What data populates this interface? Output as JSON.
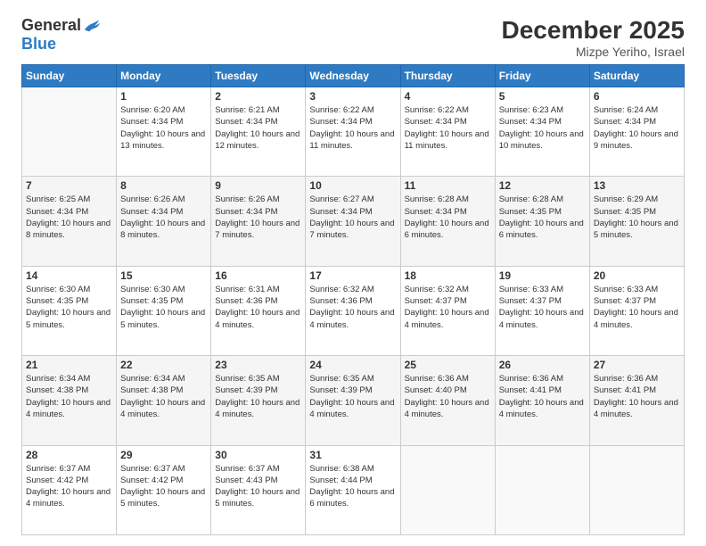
{
  "logo": {
    "general": "General",
    "blue": "Blue"
  },
  "header": {
    "month": "December 2025",
    "location": "Mizpe Yeriho, Israel"
  },
  "days_of_week": [
    "Sunday",
    "Monday",
    "Tuesday",
    "Wednesday",
    "Thursday",
    "Friday",
    "Saturday"
  ],
  "weeks": [
    [
      {
        "day": "",
        "info": ""
      },
      {
        "day": "1",
        "info": "Sunrise: 6:20 AM\nSunset: 4:34 PM\nDaylight: 10 hours\nand 13 minutes."
      },
      {
        "day": "2",
        "info": "Sunrise: 6:21 AM\nSunset: 4:34 PM\nDaylight: 10 hours\nand 12 minutes."
      },
      {
        "day": "3",
        "info": "Sunrise: 6:22 AM\nSunset: 4:34 PM\nDaylight: 10 hours\nand 11 minutes."
      },
      {
        "day": "4",
        "info": "Sunrise: 6:22 AM\nSunset: 4:34 PM\nDaylight: 10 hours\nand 11 minutes."
      },
      {
        "day": "5",
        "info": "Sunrise: 6:23 AM\nSunset: 4:34 PM\nDaylight: 10 hours\nand 10 minutes."
      },
      {
        "day": "6",
        "info": "Sunrise: 6:24 AM\nSunset: 4:34 PM\nDaylight: 10 hours\nand 9 minutes."
      }
    ],
    [
      {
        "day": "7",
        "info": "Sunrise: 6:25 AM\nSunset: 4:34 PM\nDaylight: 10 hours\nand 8 minutes."
      },
      {
        "day": "8",
        "info": "Sunrise: 6:26 AM\nSunset: 4:34 PM\nDaylight: 10 hours\nand 8 minutes."
      },
      {
        "day": "9",
        "info": "Sunrise: 6:26 AM\nSunset: 4:34 PM\nDaylight: 10 hours\nand 7 minutes."
      },
      {
        "day": "10",
        "info": "Sunrise: 6:27 AM\nSunset: 4:34 PM\nDaylight: 10 hours\nand 7 minutes."
      },
      {
        "day": "11",
        "info": "Sunrise: 6:28 AM\nSunset: 4:34 PM\nDaylight: 10 hours\nand 6 minutes."
      },
      {
        "day": "12",
        "info": "Sunrise: 6:28 AM\nSunset: 4:35 PM\nDaylight: 10 hours\nand 6 minutes."
      },
      {
        "day": "13",
        "info": "Sunrise: 6:29 AM\nSunset: 4:35 PM\nDaylight: 10 hours\nand 5 minutes."
      }
    ],
    [
      {
        "day": "14",
        "info": "Sunrise: 6:30 AM\nSunset: 4:35 PM\nDaylight: 10 hours\nand 5 minutes."
      },
      {
        "day": "15",
        "info": "Sunrise: 6:30 AM\nSunset: 4:35 PM\nDaylight: 10 hours\nand 5 minutes."
      },
      {
        "day": "16",
        "info": "Sunrise: 6:31 AM\nSunset: 4:36 PM\nDaylight: 10 hours\nand 4 minutes."
      },
      {
        "day": "17",
        "info": "Sunrise: 6:32 AM\nSunset: 4:36 PM\nDaylight: 10 hours\nand 4 minutes."
      },
      {
        "day": "18",
        "info": "Sunrise: 6:32 AM\nSunset: 4:37 PM\nDaylight: 10 hours\nand 4 minutes."
      },
      {
        "day": "19",
        "info": "Sunrise: 6:33 AM\nSunset: 4:37 PM\nDaylight: 10 hours\nand 4 minutes."
      },
      {
        "day": "20",
        "info": "Sunrise: 6:33 AM\nSunset: 4:37 PM\nDaylight: 10 hours\nand 4 minutes."
      }
    ],
    [
      {
        "day": "21",
        "info": "Sunrise: 6:34 AM\nSunset: 4:38 PM\nDaylight: 10 hours\nand 4 minutes."
      },
      {
        "day": "22",
        "info": "Sunrise: 6:34 AM\nSunset: 4:38 PM\nDaylight: 10 hours\nand 4 minutes."
      },
      {
        "day": "23",
        "info": "Sunrise: 6:35 AM\nSunset: 4:39 PM\nDaylight: 10 hours\nand 4 minutes."
      },
      {
        "day": "24",
        "info": "Sunrise: 6:35 AM\nSunset: 4:39 PM\nDaylight: 10 hours\nand 4 minutes."
      },
      {
        "day": "25",
        "info": "Sunrise: 6:36 AM\nSunset: 4:40 PM\nDaylight: 10 hours\nand 4 minutes."
      },
      {
        "day": "26",
        "info": "Sunrise: 6:36 AM\nSunset: 4:41 PM\nDaylight: 10 hours\nand 4 minutes."
      },
      {
        "day": "27",
        "info": "Sunrise: 6:36 AM\nSunset: 4:41 PM\nDaylight: 10 hours\nand 4 minutes."
      }
    ],
    [
      {
        "day": "28",
        "info": "Sunrise: 6:37 AM\nSunset: 4:42 PM\nDaylight: 10 hours\nand 4 minutes."
      },
      {
        "day": "29",
        "info": "Sunrise: 6:37 AM\nSunset: 4:42 PM\nDaylight: 10 hours\nand 5 minutes."
      },
      {
        "day": "30",
        "info": "Sunrise: 6:37 AM\nSunset: 4:43 PM\nDaylight: 10 hours\nand 5 minutes."
      },
      {
        "day": "31",
        "info": "Sunrise: 6:38 AM\nSunset: 4:44 PM\nDaylight: 10 hours\nand 6 minutes."
      },
      {
        "day": "",
        "info": ""
      },
      {
        "day": "",
        "info": ""
      },
      {
        "day": "",
        "info": ""
      }
    ]
  ]
}
